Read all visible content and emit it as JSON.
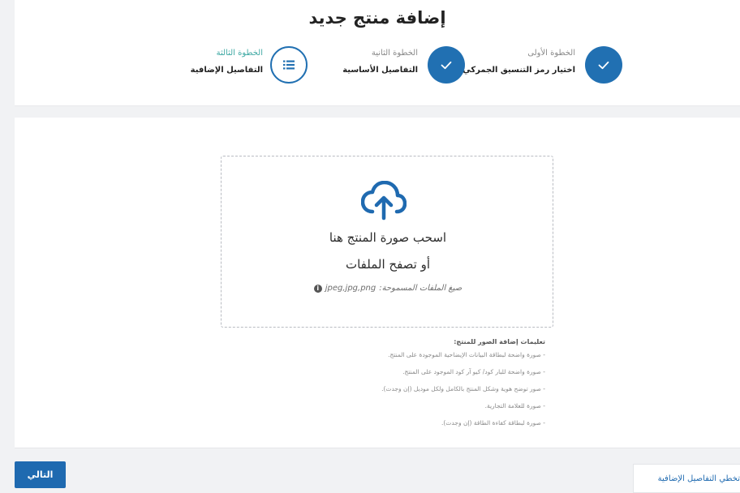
{
  "header": {
    "title": "إضافة منتج جديد"
  },
  "steps": [
    {
      "caption": "الخطوة الأولى",
      "label": "اختيار رمز التنسيق الجمركي",
      "state": "completed",
      "icon": "check-icon"
    },
    {
      "caption": "الخطوة الثانية",
      "label": "التفاصيل الأساسية",
      "state": "completed",
      "icon": "check-icon"
    },
    {
      "caption": "الخطوة الثالثة",
      "label": "التفاصيل الإضافية",
      "state": "current",
      "icon": "list-icon"
    }
  ],
  "upload": {
    "icon": "cloud-upload-icon",
    "drag_text": "اسحب صورة المنتج هنا",
    "browse_text": "أو تصفح الملفات",
    "formats_label": "صيغ الملفات المسموحة:",
    "formats_value": "jpeg,jpg,png",
    "info_icon": "info-icon"
  },
  "instructions": {
    "title": "تعليمات إضافة الصور للمنتج:",
    "items": [
      "- صورة واضحة لبطاقة البيانات الإيضاحية الموجودة على المنتج.",
      "- صورة واضحة للبار كود/ كيو آر كود الموجود على المنتج.",
      "- صور توضح هوية وشكل المنتج بالكامل ولكل موديل (إن وجدت).",
      "- صورة للعلامة التجارية.",
      "- صورة لبطاقة كفاءة الطاقة (إن وجدت)."
    ]
  },
  "footer": {
    "next_label": "التالي",
    "skip_label": "تخطي التفاصيل الإضافية"
  },
  "colors": {
    "primary": "#2170b2",
    "accent_teal": "#3fa9a4",
    "background": "#f1f2f4"
  }
}
